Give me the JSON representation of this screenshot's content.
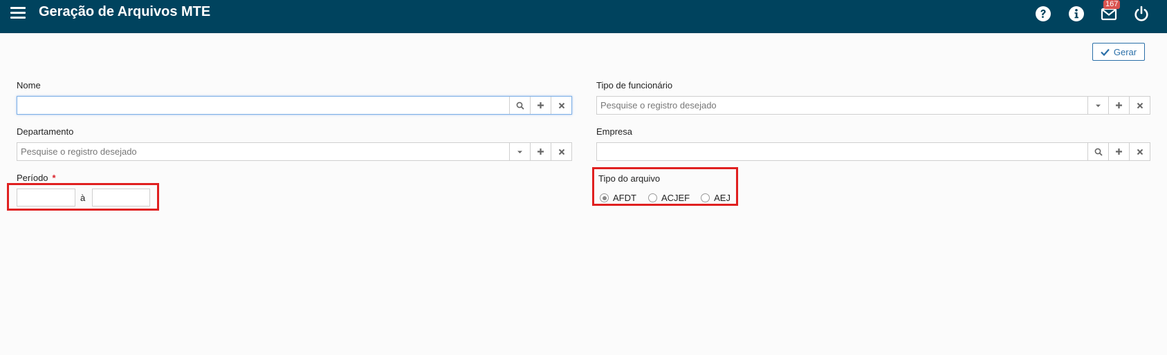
{
  "header": {
    "title": "Geração de Arquivos MTE",
    "notifications_count": "167",
    "icons": [
      "menu-icon",
      "help-icon",
      "info-icon",
      "mail-icon",
      "power-icon"
    ]
  },
  "toolbar": {
    "gerar_label": "Gerar"
  },
  "form": {
    "nome": {
      "label": "Nome",
      "value": "",
      "placeholder": ""
    },
    "tipo_funcionario": {
      "label": "Tipo de funcionário",
      "placeholder": "Pesquise o registro desejado"
    },
    "departamento": {
      "label": "Departamento",
      "placeholder": "Pesquise o registro desejado"
    },
    "empresa": {
      "label": "Empresa",
      "value": "",
      "placeholder": ""
    },
    "periodo": {
      "label": "Período",
      "required_mark": "*",
      "separator": "à",
      "start": "",
      "end": ""
    },
    "tipo_arquivo": {
      "label": "Tipo do arquivo",
      "options": [
        "AFDT",
        "ACJEF",
        "AEJ"
      ],
      "selected": "AFDT"
    }
  },
  "colors": {
    "header_bg": "#00435e",
    "accent": "#2a6fa8",
    "highlight": "#e02020",
    "badge": "#d9534f"
  }
}
